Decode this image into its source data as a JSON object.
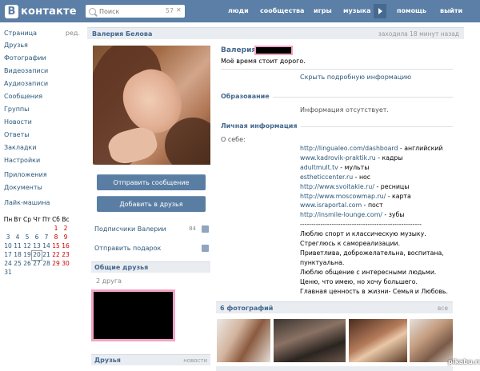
{
  "header": {
    "logo_letter": "В",
    "logo_text": "контакте",
    "search_placeholder": "Поиск",
    "search_count": "57",
    "nav": [
      "люди",
      "сообщества",
      "игры",
      "музыка",
      "помощь",
      "выйти"
    ]
  },
  "left_menu": {
    "items": [
      "Страница",
      "Друзья",
      "Фотографии",
      "Видеозаписи",
      "Аудиозаписи",
      "Сообщения",
      "Группы",
      "Новости",
      "Ответы",
      "Закладки",
      "Настройки"
    ],
    "edit_label": "ред.",
    "extra": [
      "Приложения",
      "Документы"
    ],
    "app": "Лайк-машина"
  },
  "calendar": {
    "days": [
      "Пн",
      "Вт",
      "Ср",
      "Чт",
      "Пт",
      "Сб",
      "Вс"
    ],
    "weeks": [
      [
        "",
        "",
        "",
        "",
        "",
        "1",
        "2"
      ],
      [
        "3",
        "4",
        "5",
        "6",
        "7",
        "8",
        "9"
      ],
      [
        "10",
        "11",
        "12",
        "13",
        "14",
        "15",
        "16"
      ],
      [
        "17",
        "18",
        "19",
        "20",
        "21",
        "22",
        "23"
      ],
      [
        "24",
        "25",
        "26",
        "27",
        "28",
        "29",
        "30"
      ],
      [
        "31",
        "",
        "",
        "",
        "",
        "",
        ""
      ]
    ],
    "today": "20"
  },
  "profile": {
    "name": "Валерия Белова",
    "last_seen": "заходила 18 минут назад",
    "first_name": "Валерия",
    "status": "Моё время стоит дорого.",
    "more_info": "Скрыть подробную информацию",
    "education_title": "Образование",
    "education_text": "Информация отсутствует.",
    "personal_title": "Личная информация",
    "about_label": "О себе:"
  },
  "about_lines": [
    {
      "link": "http://lingualeo.com/dashboard",
      "text": " - английский"
    },
    {
      "link": "www.kadrovik-praktik.ru",
      "text": " - кадры"
    },
    {
      "link": "adultmult.tv",
      "text": " - мульты"
    },
    {
      "link": "estheticcenter.ru",
      "text": " - нос"
    },
    {
      "link": "http://www.svoitakie.ru/",
      "text": " - ресницы"
    },
    {
      "link": "http://www.moscowmap.ru/",
      "text": " - карта"
    },
    {
      "link": "www.israportal.com",
      "text": " - пост"
    },
    {
      "link": "http://insmile-lounge.com/",
      "text": " - зубы"
    },
    {
      "link": "",
      "text": "------------------------------------------------------"
    },
    {
      "link": "",
      "text": "Люблю спорт и классическую музыку."
    },
    {
      "link": "",
      "text": "Стреглюсь к самореализации."
    },
    {
      "link": "",
      "text": "Приветлива, доброжелательна, воспитана,"
    },
    {
      "link": "",
      "text": "пунктуальна."
    },
    {
      "link": "",
      "text": "Люблю общение с интересными людьми."
    },
    {
      "link": "",
      "text": "Ценю, что имею, но хочу большего."
    },
    {
      "link": "",
      "text": "Главная ценность в жизни- Семья и Любовь."
    }
  ],
  "actions": {
    "send_message": "Отправить сообщение",
    "add_friend": "Добавить в друзья",
    "subscribers": "Подписчики Валерии",
    "subscribers_count": "84",
    "send_gift": "Отправить подарок"
  },
  "common_friends": {
    "title": "Общие друзья",
    "count": "2 друга"
  },
  "friends": {
    "title": "Друзья",
    "right": "новости"
  },
  "photos": {
    "title": "6 фотографий",
    "all": "все"
  },
  "watermark": "pikabu.ru"
}
